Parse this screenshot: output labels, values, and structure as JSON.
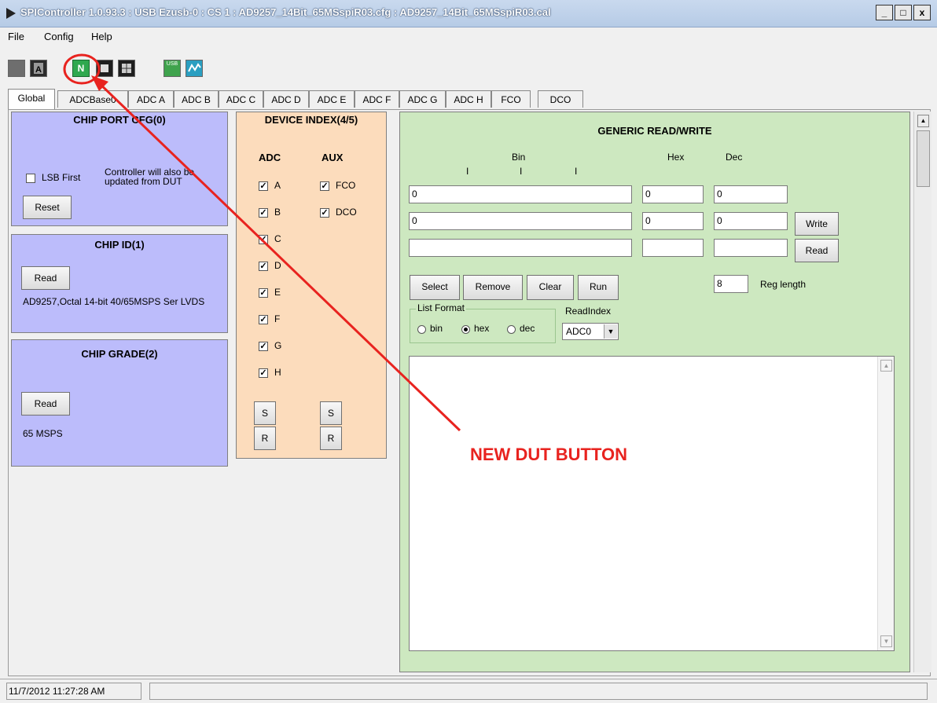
{
  "window": {
    "title": "SPIController 1.0.93.3 : USB Ezusb-0 : CS 1 : AD9257_14Bit_65MSspiR03.cfg : AD9257_14Bit_65MSspiR03.cal",
    "btn_min": "_",
    "btn_max": "□",
    "btn_close": "x"
  },
  "menu": {
    "file": "File",
    "config": "Config",
    "help": "Help"
  },
  "toolbar": {
    "new_dut_letter": "N",
    "usb_label": "USB"
  },
  "tabs": [
    "Global",
    "ADCBase0",
    "ADC A",
    "ADC B",
    "ADC C",
    "ADC D",
    "ADC E",
    "ADC F",
    "ADC G",
    "ADC H",
    "FCO",
    "DCO"
  ],
  "chip_port_cfg": {
    "title": "CHIP PORT CFG(0)",
    "lsb_first": "LSB First",
    "controller_note": "Controller will also be updated from DUT",
    "reset": "Reset"
  },
  "chip_id": {
    "title": "CHIP ID(1)",
    "read": "Read",
    "value": "AD9257,Octal 14-bit 40/65MSPS Ser LVDS"
  },
  "chip_grade": {
    "title": "CHIP GRADE(2)",
    "read": "Read",
    "value": "65 MSPS"
  },
  "device_index": {
    "title": "DEVICE INDEX(4/5)",
    "adc_header": "ADC",
    "aux_header": "AUX",
    "adc_items": [
      "A",
      "B",
      "C",
      "D",
      "E",
      "F",
      "G",
      "H"
    ],
    "aux_items": [
      "FCO",
      "DCO"
    ],
    "s_label": "S",
    "r_label": "R",
    "check_mark": "✓"
  },
  "generic_rw": {
    "title": "GENERIC READ/WRITE",
    "bin_header": "Bin",
    "hex_header": "Hex",
    "dec_header": "Dec",
    "bin_tick": "I",
    "row1": {
      "bin": "0",
      "hex": "0",
      "dec": "0"
    },
    "row2": {
      "bin": "0",
      "hex": "0",
      "dec": "0"
    },
    "row3": {
      "bin": "",
      "hex": "",
      "dec": ""
    },
    "write": "Write",
    "read": "Read",
    "select": "Select",
    "remove": "Remove",
    "clear": "Clear",
    "run": "Run",
    "reg_length_value": "8",
    "reg_length_label": "Reg length",
    "list_format_label": "List Format",
    "fmt_bin": "bin",
    "fmt_hex": "hex",
    "fmt_dec": "dec",
    "read_index_label": "ReadIndex",
    "read_index_value": "ADC0"
  },
  "status": {
    "timestamp": "11/7/2012 11:27:28 AM"
  },
  "annotation": {
    "label": "NEW DUT BUTTON",
    "color": "#e8231f"
  },
  "colors": {
    "purple_panel": "#bcbcfb",
    "peach_panel": "#fcdcbc",
    "green_panel": "#cde8c0"
  }
}
